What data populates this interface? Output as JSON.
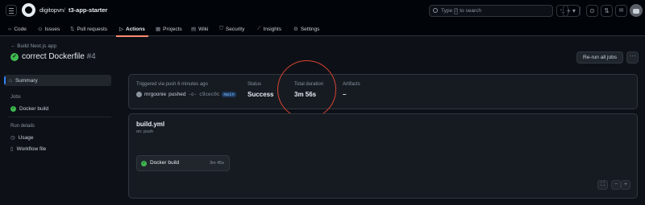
{
  "header": {
    "owner": "digitopvn",
    "separator": "/",
    "repo": "t3-app-starter",
    "search_prefix": "Type",
    "search_key": "/",
    "search_suffix": "to search",
    "terminal_glyph": "›_",
    "plus_glyph": "+ ▾",
    "issues_glyph": "⊙",
    "pulls_glyph": "⇅",
    "inbox_glyph": "✉"
  },
  "nav": {
    "tabs": [
      {
        "icon": "‹›",
        "label": "Code"
      },
      {
        "icon": "⊙",
        "label": "Issues"
      },
      {
        "icon": "⇅",
        "label": "Pull requests"
      },
      {
        "icon": "▷",
        "label": "Actions"
      },
      {
        "icon": "▦",
        "label": "Projects"
      },
      {
        "icon": "▤",
        "label": "Wiki"
      },
      {
        "icon": "⛉",
        "label": "Security"
      },
      {
        "icon": "⟋",
        "label": "Insights"
      },
      {
        "icon": "⚙",
        "label": "Settings"
      }
    ]
  },
  "run": {
    "back_label": "← Build Next.js app",
    "title": "correct Dockerfile",
    "number": "#4",
    "rerun_label": "Re-run all jobs",
    "more_label": "···"
  },
  "sidebar": {
    "summary_label": "Summary",
    "jobs_heading": "Jobs",
    "job_label": "Docker build",
    "details_heading": "Run details",
    "usage_label": "Usage",
    "workflow_file_label": "Workflow file"
  },
  "summary": {
    "trigger_text": "Triggered via push 6 minutes ago",
    "actor": "mrgoonie",
    "action": "pushed",
    "sha": "c9cec0c",
    "branch": "main",
    "status_label": "Status",
    "status_value": "Success",
    "duration_label": "Total duration",
    "duration_value": "3m 56s",
    "artifacts_label": "Artifacts",
    "artifacts_value": "–"
  },
  "workflow": {
    "name": "build.yml",
    "trigger": "on: push",
    "job_name": "Docker build",
    "job_duration": "3m 45s",
    "zoom_fit": "⛶",
    "zoom_out": "−",
    "zoom_in": "+"
  },
  "colors": {
    "success": "#3fb950",
    "annotation": "#d9442f",
    "active_tab": "#fd8c73"
  }
}
